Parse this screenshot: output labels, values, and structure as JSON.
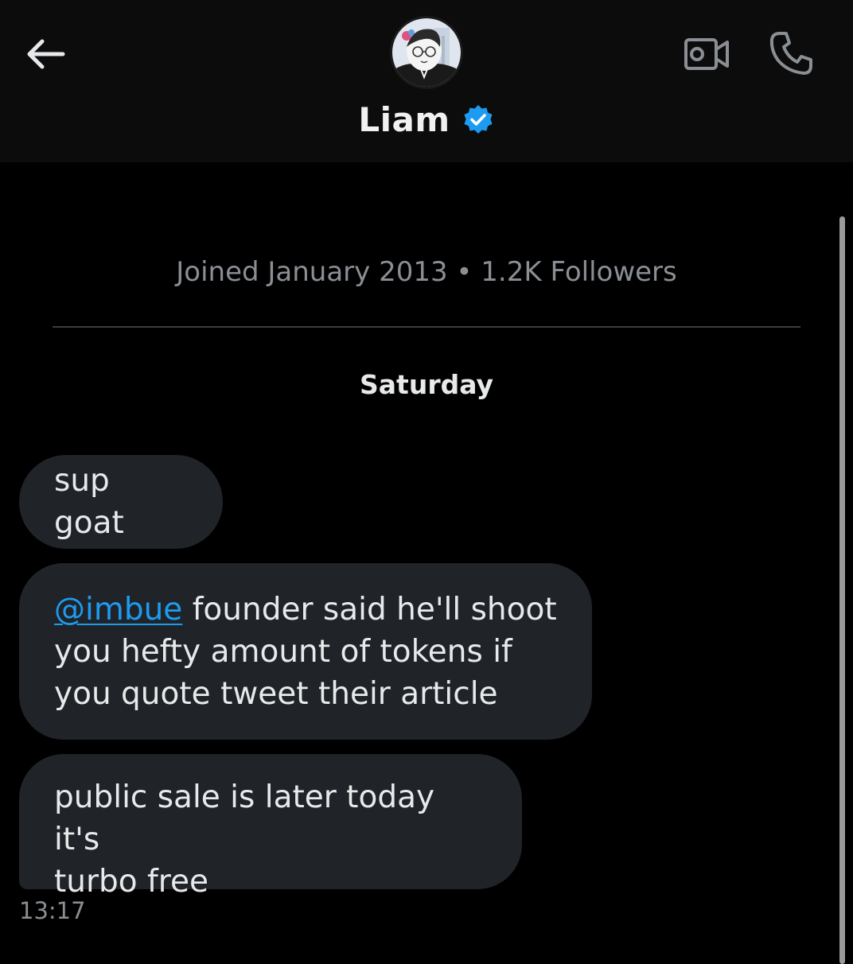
{
  "header": {
    "back_icon": "arrow-left-icon",
    "avatar_icon": "cartoon-avatar",
    "name": "Liam",
    "verified_icon": "verified-badge-icon",
    "video_icon": "video-camera-icon",
    "call_icon": "phone-icon"
  },
  "profile": {
    "joined": "Joined January 2013",
    "separator": " • ",
    "followers": "1.2K Followers"
  },
  "date_separator": "Saturday",
  "messages": [
    {
      "text": "sup goat"
    },
    {
      "mention": "@imbue",
      "text_line1": " founder said he'll shoot",
      "text_line2": "you hefty amount of tokens if",
      "text_line3": "you quote tweet their article"
    },
    {
      "text_line1": "public sale is later today it's",
      "text_line2": "turbo free"
    }
  ],
  "last_timestamp": "13:17",
  "colors": {
    "background": "#000000",
    "header": "#0c0c0d",
    "bubble": "#202327",
    "accent": "#1d9bf0",
    "muted_text": "#8b8f94"
  }
}
